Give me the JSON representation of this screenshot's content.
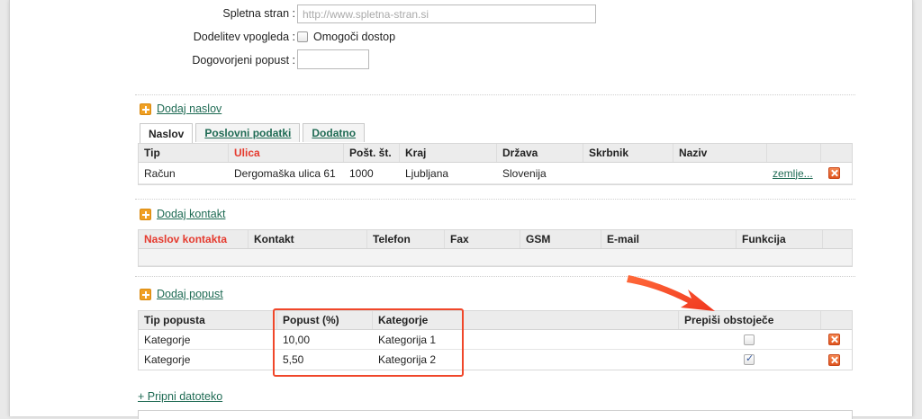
{
  "form": {
    "website_label": "Spletna stran :",
    "website_placeholder": "http://www.spletna-stran.si",
    "share_label": "Dodelitev vpogleda :",
    "share_option": "Omogoči dostop",
    "discount_label": "Dogovorjeni popust :",
    "discount_value": ""
  },
  "address": {
    "add_label": "Dodaj naslov",
    "tabs": [
      {
        "label": "Naslov"
      },
      {
        "label": "Poslovni podatki"
      },
      {
        "label": "Dodatno"
      }
    ],
    "columns": [
      "Tip",
      "Ulica",
      "Pošt. št.",
      "Kraj",
      "Država",
      "Skrbnik",
      "Naziv"
    ],
    "rows": [
      {
        "tip": "Račun",
        "ulica": "Dergomaška ulica 61",
        "posta": "1000",
        "kraj": "Ljubljana",
        "drzava": "Slovenija",
        "skrbnik": "",
        "naziv": "",
        "link": "zemlje..."
      }
    ]
  },
  "contact": {
    "add_label": "Dodaj kontakt",
    "columns": [
      "Naslov kontakta",
      "Kontakt",
      "Telefon",
      "Fax",
      "GSM",
      "E-mail",
      "Funkcija"
    ]
  },
  "discount": {
    "add_label": "Dodaj popust",
    "columns": [
      "Tip popusta",
      "Popust (%)",
      "Kategorje",
      "Prepiši obstoječe"
    ],
    "rows": [
      {
        "tip": "Kategorje",
        "popust": "10,00",
        "kategorija": "Kategorija 1",
        "overwrite": false
      },
      {
        "tip": "Kategorje",
        "popust": "5,50",
        "kategorija": "Kategorija 2",
        "overwrite": true
      }
    ]
  },
  "attach_label": "+ Pripni datoteko",
  "colors": {
    "link": "#1f6b54",
    "required_header": "#e53a2e",
    "annotation": "#f0472a",
    "add_icon": "#f0a024"
  }
}
